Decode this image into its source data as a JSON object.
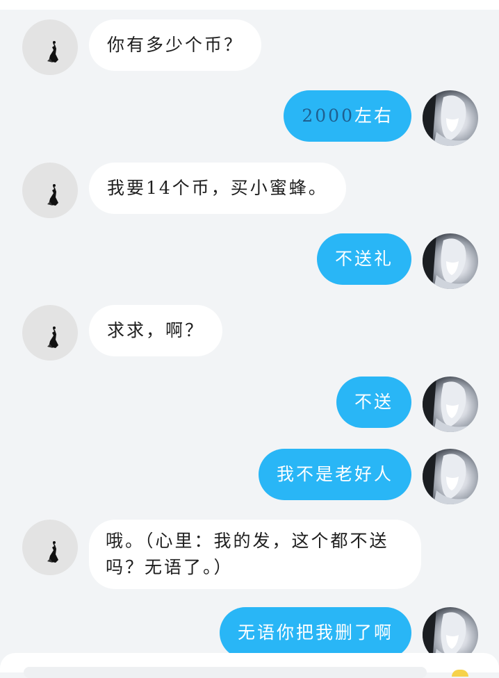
{
  "messages": [
    {
      "side": "in",
      "text": "你有多少个币？"
    },
    {
      "side": "out",
      "text_num": "2000",
      "text": "左右"
    },
    {
      "side": "in",
      "text": "我要14个币，买小蜜蜂。"
    },
    {
      "side": "out",
      "text": "不送礼"
    },
    {
      "side": "in",
      "text": "求求，啊？"
    },
    {
      "side": "out",
      "text": "不送"
    },
    {
      "side": "out",
      "text": "我不是老好人"
    },
    {
      "side": "in",
      "text": "哦。（心里：我的发，这个都不送吗？无语了。）"
    },
    {
      "side": "out",
      "text": "无语你把我删了啊"
    }
  ],
  "colors": {
    "background": "#f2f4f6",
    "incoming_bubble": "#ffffff",
    "outgoing_bubble": "#29b6f6",
    "outgoing_text": "#ffffff"
  },
  "icons": {
    "contact_avatar": "ink-figure-avatar",
    "self_avatar": "anime-girl-avatar"
  }
}
